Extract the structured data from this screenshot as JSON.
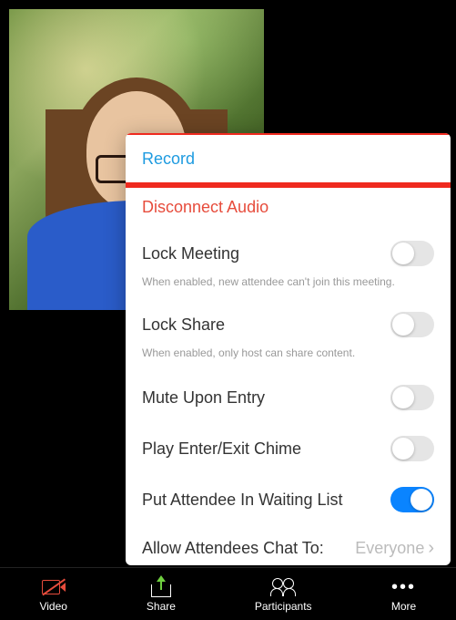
{
  "menu": {
    "record_label": "Record",
    "disconnect_label": "Disconnect Audio",
    "lock_meeting": {
      "label": "Lock Meeting",
      "hint": "When enabled, new attendee can't join this meeting.",
      "on": false
    },
    "lock_share": {
      "label": "Lock Share",
      "hint": "When enabled, only host can share content.",
      "on": false
    },
    "mute_entry": {
      "label": "Mute Upon Entry",
      "on": false
    },
    "chime": {
      "label": "Play Enter/Exit Chime",
      "on": false
    },
    "waiting_list": {
      "label": "Put Attendee In Waiting List",
      "on": true
    },
    "chat_to": {
      "label": "Allow Attendees Chat To:",
      "value": "Everyone"
    }
  },
  "bottom_bar": {
    "video": "Video",
    "share": "Share",
    "participants": "Participants",
    "more": "More"
  }
}
